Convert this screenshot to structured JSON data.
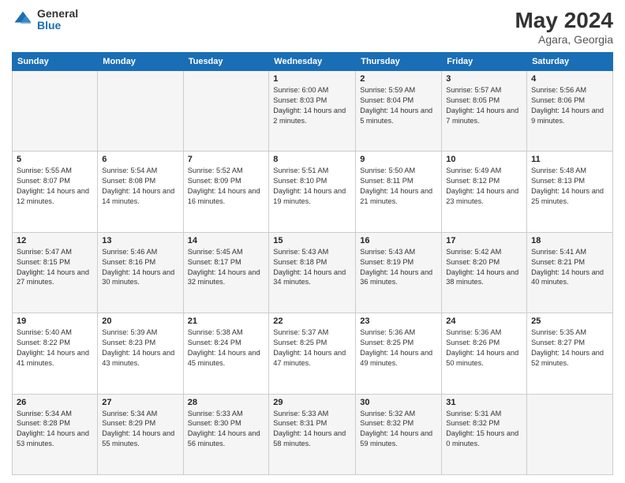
{
  "header": {
    "logo_general": "General",
    "logo_blue": "Blue",
    "month_year": "May 2024",
    "location": "Agara, Georgia"
  },
  "days_of_week": [
    "Sunday",
    "Monday",
    "Tuesday",
    "Wednesday",
    "Thursday",
    "Friday",
    "Saturday"
  ],
  "weeks": [
    [
      {
        "day": "",
        "sunrise": "",
        "sunset": "",
        "daylight": ""
      },
      {
        "day": "",
        "sunrise": "",
        "sunset": "",
        "daylight": ""
      },
      {
        "day": "",
        "sunrise": "",
        "sunset": "",
        "daylight": ""
      },
      {
        "day": "1",
        "sunrise": "Sunrise: 6:00 AM",
        "sunset": "Sunset: 8:03 PM",
        "daylight": "Daylight: 14 hours and 2 minutes."
      },
      {
        "day": "2",
        "sunrise": "Sunrise: 5:59 AM",
        "sunset": "Sunset: 8:04 PM",
        "daylight": "Daylight: 14 hours and 5 minutes."
      },
      {
        "day": "3",
        "sunrise": "Sunrise: 5:57 AM",
        "sunset": "Sunset: 8:05 PM",
        "daylight": "Daylight: 14 hours and 7 minutes."
      },
      {
        "day": "4",
        "sunrise": "Sunrise: 5:56 AM",
        "sunset": "Sunset: 8:06 PM",
        "daylight": "Daylight: 14 hours and 9 minutes."
      }
    ],
    [
      {
        "day": "5",
        "sunrise": "Sunrise: 5:55 AM",
        "sunset": "Sunset: 8:07 PM",
        "daylight": "Daylight: 14 hours and 12 minutes."
      },
      {
        "day": "6",
        "sunrise": "Sunrise: 5:54 AM",
        "sunset": "Sunset: 8:08 PM",
        "daylight": "Daylight: 14 hours and 14 minutes."
      },
      {
        "day": "7",
        "sunrise": "Sunrise: 5:52 AM",
        "sunset": "Sunset: 8:09 PM",
        "daylight": "Daylight: 14 hours and 16 minutes."
      },
      {
        "day": "8",
        "sunrise": "Sunrise: 5:51 AM",
        "sunset": "Sunset: 8:10 PM",
        "daylight": "Daylight: 14 hours and 19 minutes."
      },
      {
        "day": "9",
        "sunrise": "Sunrise: 5:50 AM",
        "sunset": "Sunset: 8:11 PM",
        "daylight": "Daylight: 14 hours and 21 minutes."
      },
      {
        "day": "10",
        "sunrise": "Sunrise: 5:49 AM",
        "sunset": "Sunset: 8:12 PM",
        "daylight": "Daylight: 14 hours and 23 minutes."
      },
      {
        "day": "11",
        "sunrise": "Sunrise: 5:48 AM",
        "sunset": "Sunset: 8:13 PM",
        "daylight": "Daylight: 14 hours and 25 minutes."
      }
    ],
    [
      {
        "day": "12",
        "sunrise": "Sunrise: 5:47 AM",
        "sunset": "Sunset: 8:15 PM",
        "daylight": "Daylight: 14 hours and 27 minutes."
      },
      {
        "day": "13",
        "sunrise": "Sunrise: 5:46 AM",
        "sunset": "Sunset: 8:16 PM",
        "daylight": "Daylight: 14 hours and 30 minutes."
      },
      {
        "day": "14",
        "sunrise": "Sunrise: 5:45 AM",
        "sunset": "Sunset: 8:17 PM",
        "daylight": "Daylight: 14 hours and 32 minutes."
      },
      {
        "day": "15",
        "sunrise": "Sunrise: 5:43 AM",
        "sunset": "Sunset: 8:18 PM",
        "daylight": "Daylight: 14 hours and 34 minutes."
      },
      {
        "day": "16",
        "sunrise": "Sunrise: 5:43 AM",
        "sunset": "Sunset: 8:19 PM",
        "daylight": "Daylight: 14 hours and 36 minutes."
      },
      {
        "day": "17",
        "sunrise": "Sunrise: 5:42 AM",
        "sunset": "Sunset: 8:20 PM",
        "daylight": "Daylight: 14 hours and 38 minutes."
      },
      {
        "day": "18",
        "sunrise": "Sunrise: 5:41 AM",
        "sunset": "Sunset: 8:21 PM",
        "daylight": "Daylight: 14 hours and 40 minutes."
      }
    ],
    [
      {
        "day": "19",
        "sunrise": "Sunrise: 5:40 AM",
        "sunset": "Sunset: 8:22 PM",
        "daylight": "Daylight: 14 hours and 41 minutes."
      },
      {
        "day": "20",
        "sunrise": "Sunrise: 5:39 AM",
        "sunset": "Sunset: 8:23 PM",
        "daylight": "Daylight: 14 hours and 43 minutes."
      },
      {
        "day": "21",
        "sunrise": "Sunrise: 5:38 AM",
        "sunset": "Sunset: 8:24 PM",
        "daylight": "Daylight: 14 hours and 45 minutes."
      },
      {
        "day": "22",
        "sunrise": "Sunrise: 5:37 AM",
        "sunset": "Sunset: 8:25 PM",
        "daylight": "Daylight: 14 hours and 47 minutes."
      },
      {
        "day": "23",
        "sunrise": "Sunrise: 5:36 AM",
        "sunset": "Sunset: 8:25 PM",
        "daylight": "Daylight: 14 hours and 49 minutes."
      },
      {
        "day": "24",
        "sunrise": "Sunrise: 5:36 AM",
        "sunset": "Sunset: 8:26 PM",
        "daylight": "Daylight: 14 hours and 50 minutes."
      },
      {
        "day": "25",
        "sunrise": "Sunrise: 5:35 AM",
        "sunset": "Sunset: 8:27 PM",
        "daylight": "Daylight: 14 hours and 52 minutes."
      }
    ],
    [
      {
        "day": "26",
        "sunrise": "Sunrise: 5:34 AM",
        "sunset": "Sunset: 8:28 PM",
        "daylight": "Daylight: 14 hours and 53 minutes."
      },
      {
        "day": "27",
        "sunrise": "Sunrise: 5:34 AM",
        "sunset": "Sunset: 8:29 PM",
        "daylight": "Daylight: 14 hours and 55 minutes."
      },
      {
        "day": "28",
        "sunrise": "Sunrise: 5:33 AM",
        "sunset": "Sunset: 8:30 PM",
        "daylight": "Daylight: 14 hours and 56 minutes."
      },
      {
        "day": "29",
        "sunrise": "Sunrise: 5:33 AM",
        "sunset": "Sunset: 8:31 PM",
        "daylight": "Daylight: 14 hours and 58 minutes."
      },
      {
        "day": "30",
        "sunrise": "Sunrise: 5:32 AM",
        "sunset": "Sunset: 8:32 PM",
        "daylight": "Daylight: 14 hours and 59 minutes."
      },
      {
        "day": "31",
        "sunrise": "Sunrise: 5:31 AM",
        "sunset": "Sunset: 8:32 PM",
        "daylight": "Daylight: 15 hours and 0 minutes."
      },
      {
        "day": "",
        "sunrise": "",
        "sunset": "",
        "daylight": ""
      }
    ]
  ]
}
